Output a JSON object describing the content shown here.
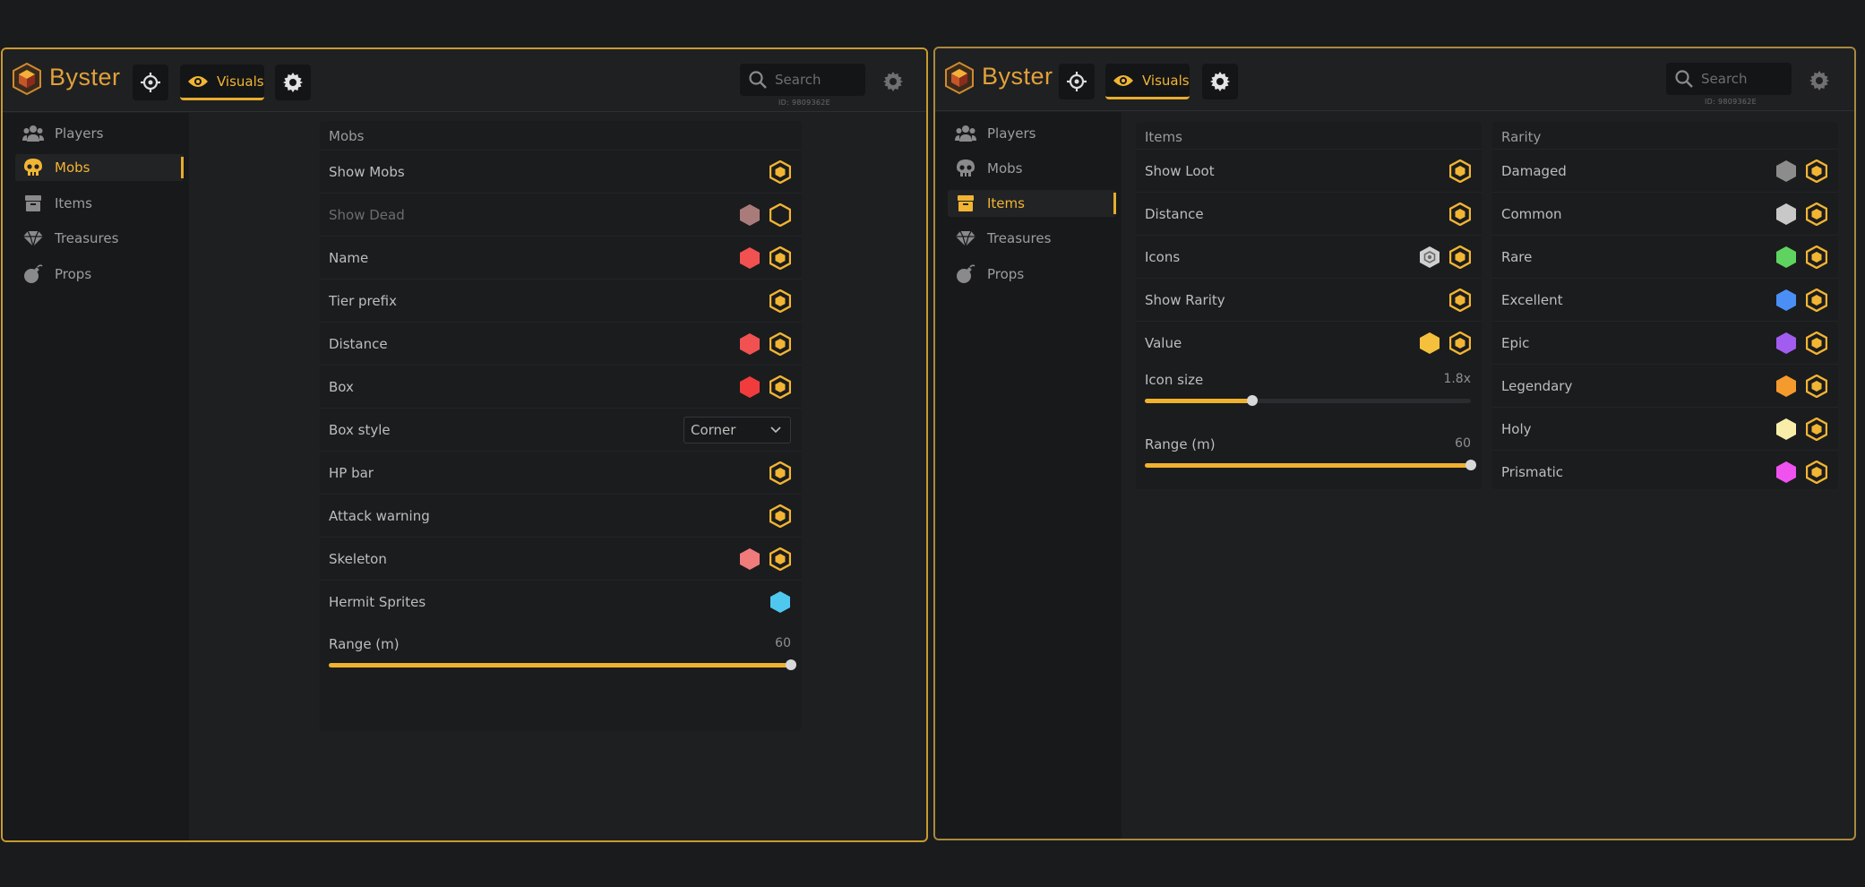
{
  "app": {
    "brand": "Byster",
    "tab_visuals": "Visuals",
    "search_placeholder": "Search",
    "id_text": "ID: 9809362E"
  },
  "sidebar": {
    "items": [
      {
        "label": "Players",
        "icon": "users-icon"
      },
      {
        "label": "Mobs",
        "icon": "skull-icon"
      },
      {
        "label": "Items",
        "icon": "box-icon"
      },
      {
        "label": "Treasures",
        "icon": "gem-icon"
      },
      {
        "label": "Props",
        "icon": "bomb-icon"
      }
    ]
  },
  "mobs": {
    "title": "Mobs",
    "rows": [
      {
        "label": "Show Mobs",
        "color": null,
        "toggle": "on"
      },
      {
        "label": "Show Dead",
        "color": "#a97b7b",
        "toggle": "off",
        "dim": true
      },
      {
        "label": "Name",
        "color": "#f15151",
        "toggle": "on"
      },
      {
        "label": "Tier prefix",
        "color": null,
        "toggle": "on"
      },
      {
        "label": "Distance",
        "color": "#f15151",
        "toggle": "on"
      },
      {
        "label": "Box",
        "color": "#f03c3c",
        "toggle": "on"
      },
      {
        "label": "Box style",
        "select": "Corner"
      },
      {
        "label": "HP bar",
        "color": null,
        "toggle": "on"
      },
      {
        "label": "Attack warning",
        "color": null,
        "toggle": "on"
      },
      {
        "label": "Skeleton",
        "color": "#f07b7b",
        "toggle": "on"
      },
      {
        "label": "Hermit Sprites",
        "color": "#4fc8f0",
        "toggle": null
      }
    ],
    "range": {
      "label": "Range (m)",
      "value": "60",
      "fraction": 1.0
    }
  },
  "items": {
    "title": "Items",
    "rows": [
      {
        "label": "Show Loot",
        "color": null,
        "toggle": "on"
      },
      {
        "label": "Distance",
        "color": null,
        "toggle": "on"
      },
      {
        "label": "Icons",
        "color": "#d0d0d0",
        "icon_style": "ring",
        "toggle": "on"
      },
      {
        "label": "Show Rarity",
        "color": null,
        "toggle": "on"
      },
      {
        "label": "Value",
        "color": "#f5c03c",
        "toggle": "on"
      }
    ],
    "icon_size": {
      "label": "Icon size",
      "value": "1.8x",
      "fraction": 0.33
    },
    "range": {
      "label": "Range (m)",
      "value": "60",
      "fraction": 1.0
    }
  },
  "rarity": {
    "title": "Rarity",
    "rows": [
      {
        "label": "Damaged",
        "color": "#8c8c8c",
        "toggle": "on"
      },
      {
        "label": "Common",
        "color": "#c8c8c8",
        "toggle": "on"
      },
      {
        "label": "Rare",
        "color": "#5fd35f",
        "toggle": "on"
      },
      {
        "label": "Excellent",
        "color": "#4a8ff5",
        "toggle": "on"
      },
      {
        "label": "Epic",
        "color": "#a25cf0",
        "toggle": "on"
      },
      {
        "label": "Legendary",
        "color": "#f59a2c",
        "toggle": "on"
      },
      {
        "label": "Holy",
        "color": "#f8eeaa",
        "toggle": "on"
      },
      {
        "label": "Prismatic",
        "color": "#f052f0",
        "toggle": "on"
      }
    ]
  },
  "colors": {
    "accent": "#f0b22e",
    "brand": "#e2a13a"
  }
}
